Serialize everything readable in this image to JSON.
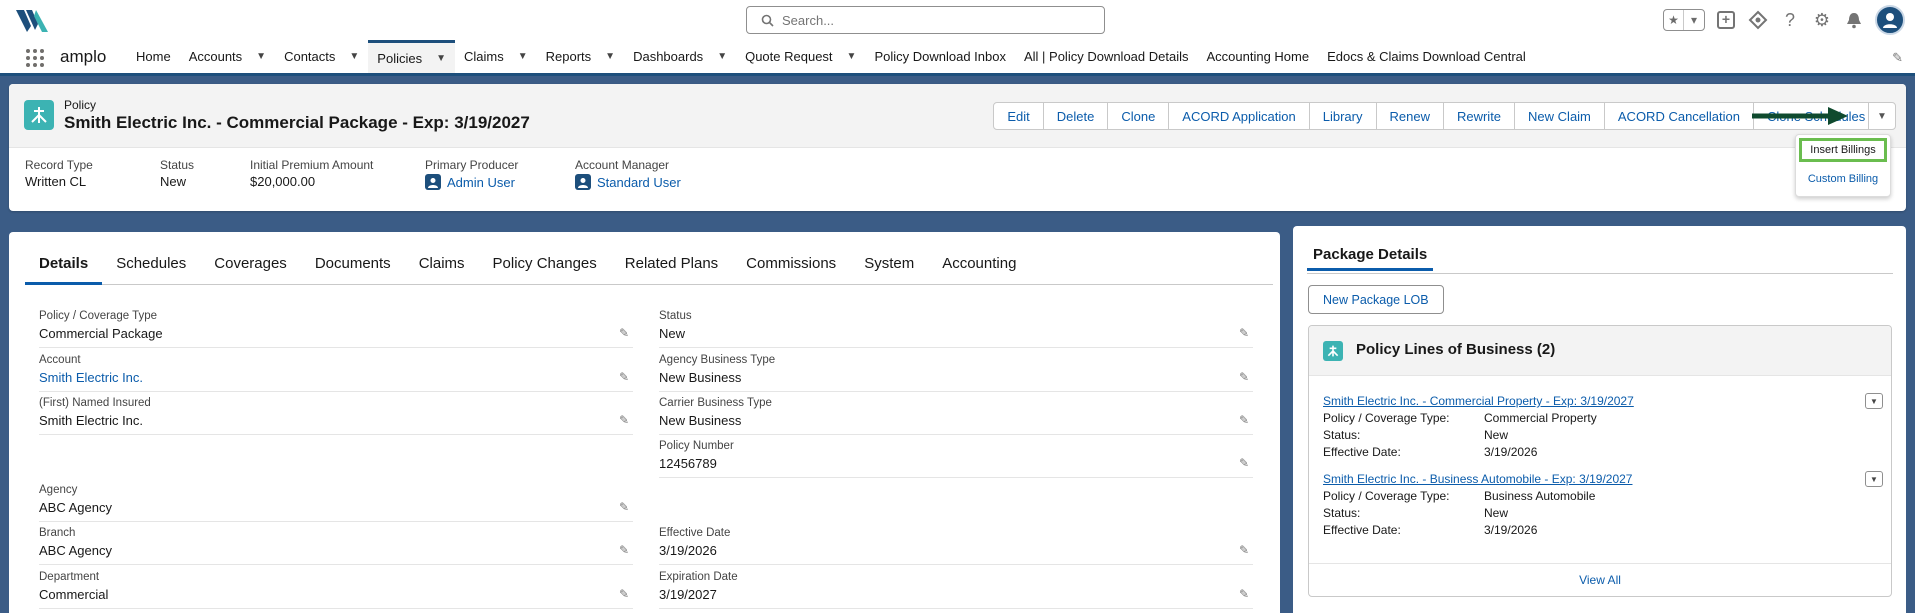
{
  "header": {
    "search_placeholder": "Search..."
  },
  "nav": {
    "app_name": "amplo",
    "items": [
      {
        "label": "Home",
        "dropdown": false,
        "active": false
      },
      {
        "label": "Accounts",
        "dropdown": true,
        "active": false
      },
      {
        "label": "Contacts",
        "dropdown": true,
        "active": false
      },
      {
        "label": "Policies",
        "dropdown": true,
        "active": true
      },
      {
        "label": "Claims",
        "dropdown": true,
        "active": false
      },
      {
        "label": "Reports",
        "dropdown": true,
        "active": false
      },
      {
        "label": "Dashboards",
        "dropdown": true,
        "active": false
      },
      {
        "label": "Quote Request",
        "dropdown": true,
        "active": false
      },
      {
        "label": "Policy Download Inbox",
        "dropdown": false,
        "active": false
      },
      {
        "label": "All | Policy Download Details",
        "dropdown": false,
        "active": false
      },
      {
        "label": "Accounting Home",
        "dropdown": false,
        "active": false
      },
      {
        "label": "Edocs & Claims Download Central",
        "dropdown": false,
        "active": false
      }
    ]
  },
  "record": {
    "object_label": "Policy",
    "title": "Smith Electric Inc. - Commercial Package - Exp: 3/19/2027",
    "actions": [
      "Edit",
      "Delete",
      "Clone",
      "ACORD Application",
      "Library",
      "Renew",
      "Rewrite",
      "New Claim",
      "ACORD Cancellation",
      "Clone Schedules"
    ],
    "highlights": [
      {
        "label": "Record Type",
        "value": "Written CL",
        "link": false
      },
      {
        "label": "Status",
        "value": "New",
        "link": false
      },
      {
        "label": "Initial Premium Amount",
        "value": "$20,000.00",
        "link": false
      },
      {
        "label": "Primary Producer",
        "value": "Admin User",
        "link": true
      },
      {
        "label": "Account Manager",
        "value": "Standard User",
        "link": true
      }
    ]
  },
  "menu": {
    "items": [
      "Insert Billings",
      "Custom Billing"
    ]
  },
  "tabs": [
    "Details",
    "Schedules",
    "Coverages",
    "Documents",
    "Claims",
    "Policy Changes",
    "Related Plans",
    "Commissions",
    "System",
    "Accounting"
  ],
  "fields": {
    "left": [
      {
        "label": "Policy / Coverage Type",
        "value": "Commercial Package",
        "link": false
      },
      {
        "label": "Account",
        "value": "Smith Electric Inc.",
        "link": true
      },
      {
        "label": "(First) Named Insured",
        "value": "Smith Electric Inc.",
        "link": false
      },
      {
        "label": "Agency",
        "value": "ABC Agency",
        "link": false
      },
      {
        "label": "Branch",
        "value": "ABC Agency",
        "link": false
      },
      {
        "label": "Department",
        "value": "Commercial",
        "link": false
      }
    ],
    "right": [
      {
        "label": "Status",
        "value": "New"
      },
      {
        "label": "Agency Business Type",
        "value": "New Business"
      },
      {
        "label": "Carrier Business Type",
        "value": "New Business"
      },
      {
        "label": "Policy Number",
        "value": "12456789"
      },
      {
        "label": "Effective Date",
        "value": "3/19/2026"
      },
      {
        "label": "Expiration Date",
        "value": "3/19/2027"
      }
    ]
  },
  "package": {
    "tab_label": "Package Details",
    "new_button": "New Package LOB",
    "lob_title": "Policy Lines of Business (2)",
    "lobs": [
      {
        "link": "Smith Electric Inc. - Commercial Property - Exp: 3/19/2027",
        "rows": [
          {
            "k": "Policy / Coverage Type:",
            "v": "Commercial Property"
          },
          {
            "k": "Status:",
            "v": "New"
          },
          {
            "k": "Effective Date:",
            "v": "3/19/2026"
          }
        ]
      },
      {
        "link": "Smith Electric Inc. - Business Automobile - Exp: 3/19/2027",
        "rows": [
          {
            "k": "Policy / Coverage Type:",
            "v": "Business Automobile"
          },
          {
            "k": "Status:",
            "v": "New"
          },
          {
            "k": "Effective Date:",
            "v": "3/19/2026"
          }
        ]
      }
    ],
    "view_all": "View All"
  },
  "colors": {
    "brand": "#1d4f7c",
    "link": "#0b5cab",
    "object_icon": "#3cb3b3",
    "menu_highlight": "#6abd4f"
  },
  "icons": [
    "amplo-logo-icon",
    "search-icon",
    "favorites-star-icon",
    "add-icon",
    "help-icon",
    "gear-icon",
    "bell-icon",
    "avatar-icon",
    "app-launcher-icon",
    "pencil-icon",
    "policy-icon",
    "user-icon",
    "arrow-icon",
    "chevron-down-icon"
  ]
}
